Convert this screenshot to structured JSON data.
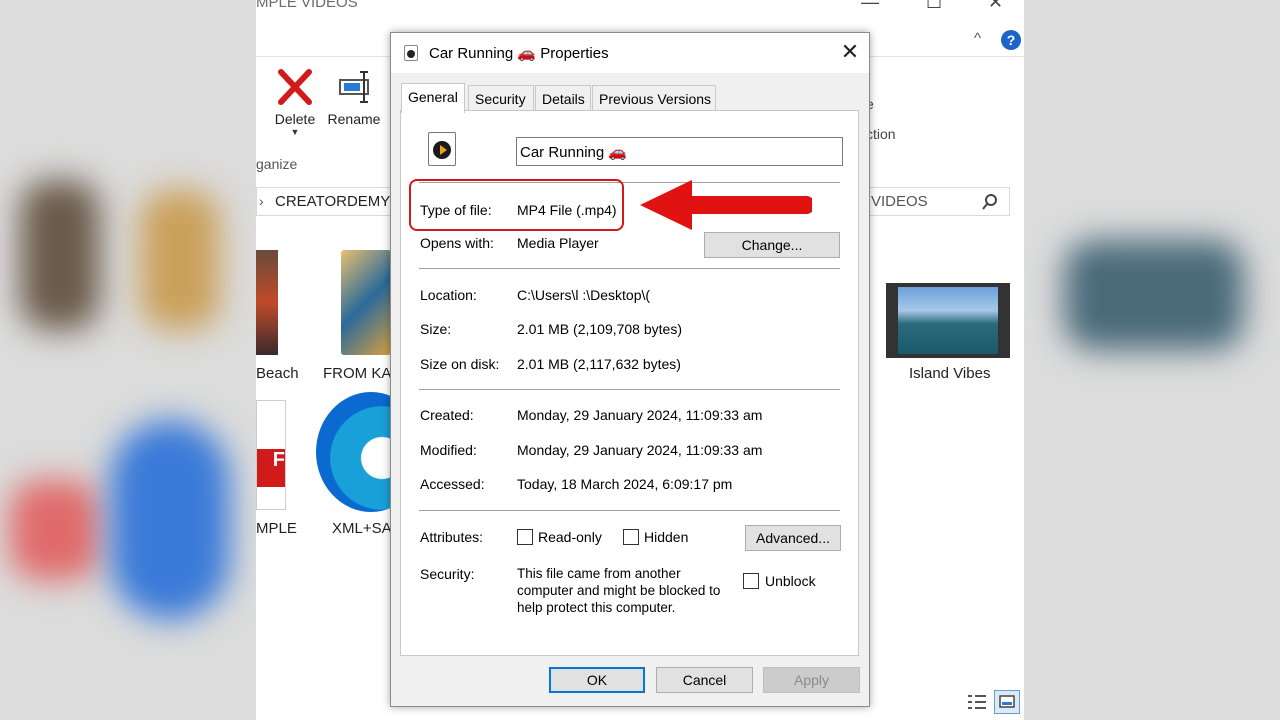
{
  "explorer": {
    "title": "MPLE VIDEOS",
    "window_controls": [
      "—",
      "☐",
      "✕"
    ],
    "ribbon": {
      "delete_label": "Delete",
      "rename_label": "Rename",
      "group_label": "ganize",
      "right_text_1": "e",
      "right_text_2": "ction"
    },
    "address": {
      "path": "CREATORDEMY",
      "search_text": "VIDEOS"
    },
    "items": [
      {
        "label": "Beach"
      },
      {
        "label": "FROM KA"
      },
      {
        "label": "Island Vibes"
      },
      {
        "label": "MPLE"
      },
      {
        "label": "XML+SA"
      }
    ],
    "help": "?"
  },
  "dialog": {
    "title": "Car Running 🚗 Properties",
    "close": "✕",
    "tabs": [
      "General",
      "Security",
      "Details",
      "Previous Versions"
    ],
    "filename": "Car Running 🚗",
    "type_label": "Type of file:",
    "type_value": "MP4 File (.mp4)",
    "opens_label": "Opens with:",
    "opens_value": "Media Player",
    "change_btn": "Change...",
    "location_label": "Location:",
    "location_value": "C:\\Users\\l              :\\Desktop\\(",
    "size_label": "Size:",
    "size_value": "2.01 MB (2,109,708 bytes)",
    "disk_label": "Size on disk:",
    "disk_value": "2.01 MB (2,117,632 bytes)",
    "created_label": "Created:",
    "created_value": "Monday, 29 January 2024, 11:09:33 am",
    "modified_label": "Modified:",
    "modified_value": "Monday, 29 January 2024, 11:09:33 am",
    "accessed_label": "Accessed:",
    "accessed_value": "Today, 18 March 2024, 6:09:17 pm",
    "attributes_label": "Attributes:",
    "readonly_label": "Read-only",
    "hidden_label": "Hidden",
    "advanced_btn": "Advanced...",
    "security_label": "Security:",
    "security_line1": "This file came from another",
    "security_line2": "computer and might be blocked to",
    "security_line3": "help protect this computer.",
    "unblock_label": "Unblock",
    "ok_btn": "OK",
    "cancel_btn": "Cancel",
    "apply_btn": "Apply"
  },
  "colors": {
    "annotation": "#d11a1a",
    "accent": "#0078d7",
    "delete_red": "#d11a1a"
  }
}
